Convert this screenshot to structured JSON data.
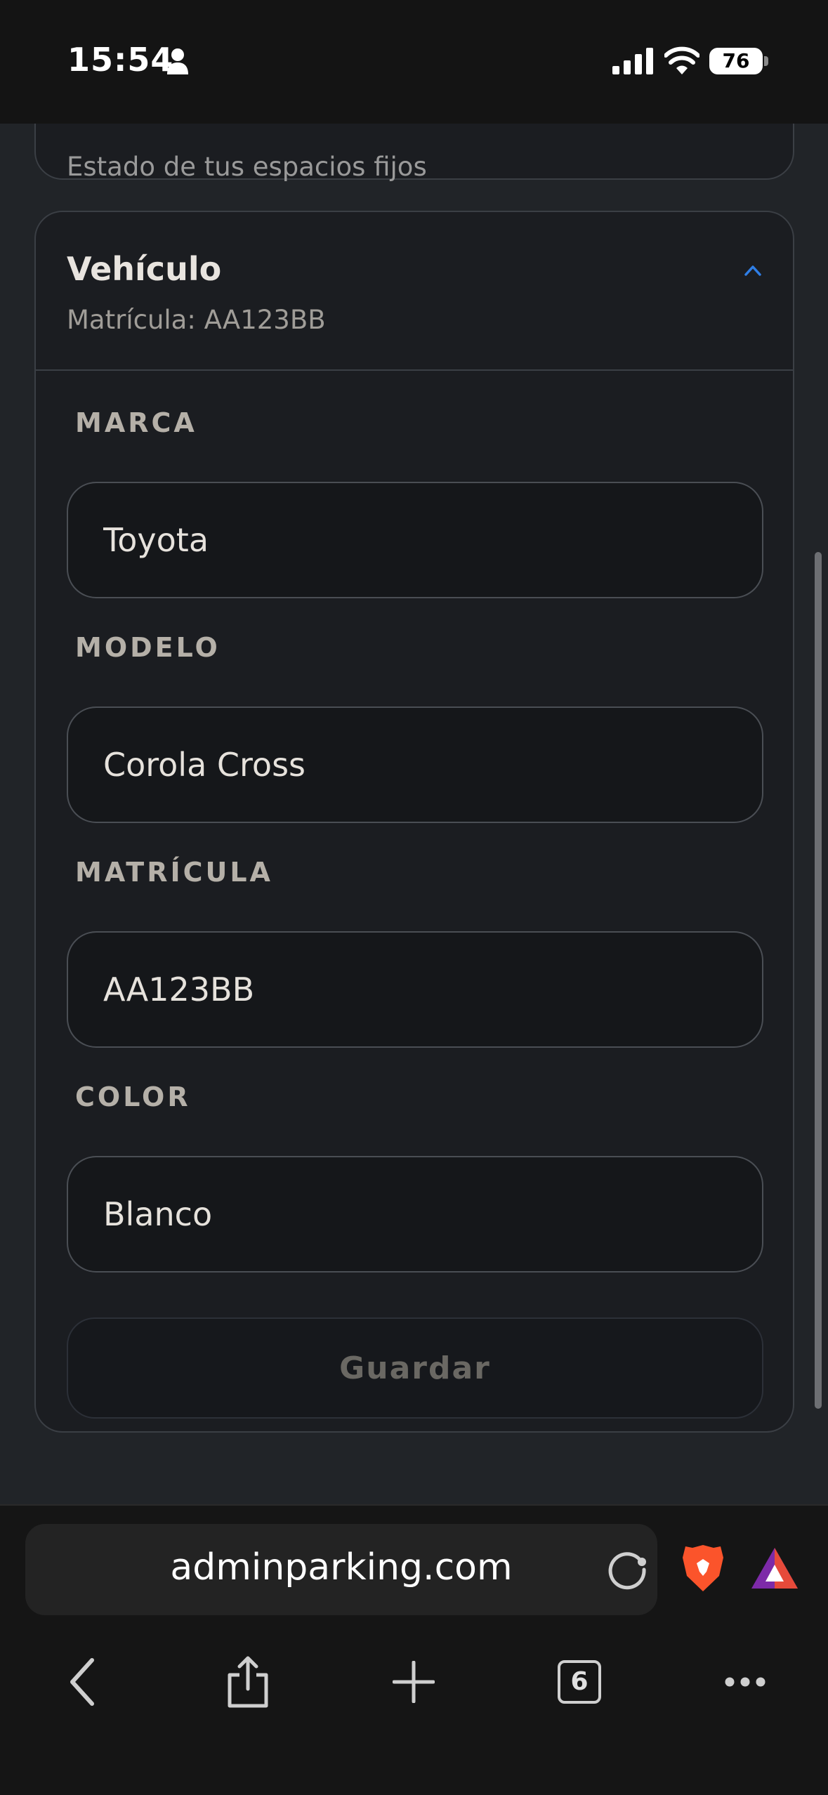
{
  "status_bar": {
    "time": "15:54",
    "battery": "76"
  },
  "previous_card": {
    "subtitle": "Estado de tus espacios fijos"
  },
  "vehicle_card": {
    "title": "Vehículo",
    "subtitle": "Matrícula: AA123BB",
    "expanded": true,
    "fields": [
      {
        "label": "MARCA",
        "value": "Toyota"
      },
      {
        "label": "MODELO",
        "value": "Corola Cross"
      },
      {
        "label": "MATRÍCULA",
        "value": "AA123BB"
      },
      {
        "label": "COLOR",
        "value": "Blanco"
      }
    ],
    "save_label": "Guardar"
  },
  "browser": {
    "url": "adminparking.com",
    "tab_count": "6"
  },
  "colors": {
    "accent": "#2f7ee6",
    "background": "#212428",
    "card": "#1b1d21"
  }
}
